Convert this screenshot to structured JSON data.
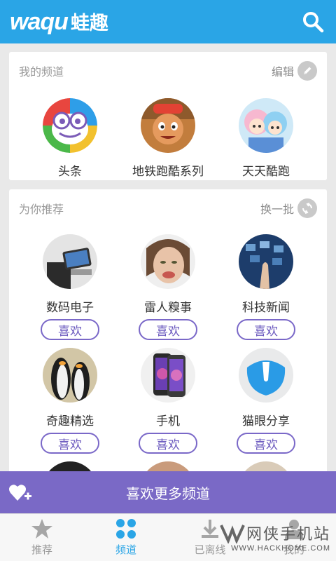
{
  "app": {
    "logo_en": "waqu",
    "logo_cn": "蛙趣"
  },
  "my_channels": {
    "title": "我的频道",
    "edit_label": "编辑",
    "items": [
      {
        "label": "头条"
      },
      {
        "label": "地铁跑酷系列"
      },
      {
        "label": "天天酷跑"
      }
    ]
  },
  "recommend": {
    "title": "为你推荐",
    "refresh_label": "换一批",
    "like_label": "喜欢",
    "items": [
      {
        "label": "数码电子"
      },
      {
        "label": "雷人糗事"
      },
      {
        "label": "科技新闻"
      },
      {
        "label": "奇趣精选"
      },
      {
        "label": "手机"
      },
      {
        "label": "猫眼分享"
      }
    ]
  },
  "banner": {
    "label": "喜欢更多频道"
  },
  "tabs": [
    {
      "label": "推荐",
      "icon": "star-icon"
    },
    {
      "label": "频道",
      "icon": "grid-icon",
      "active": true
    },
    {
      "label": "已离线",
      "icon": "download-icon"
    },
    {
      "label": "我的",
      "icon": "person-icon"
    }
  ],
  "watermark": {
    "title": "网侠手机站",
    "url": "WWW.HACKHOME.COM"
  },
  "colors": {
    "topbar": "#2aa5e6",
    "accent_purple": "#7a69c6",
    "active_tab": "#2aa5e6"
  }
}
